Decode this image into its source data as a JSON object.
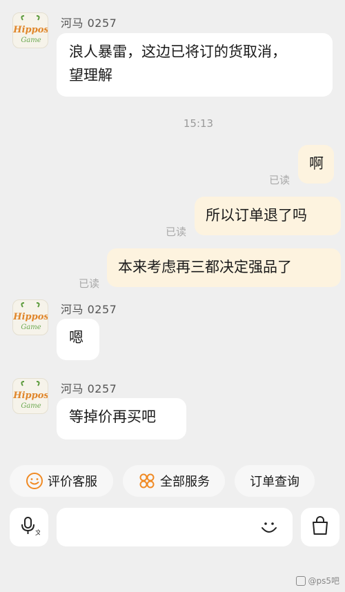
{
  "chat": {
    "messages": [
      {
        "sender": "河马 0257",
        "lines": [
          "浪人暴雷，这边已将订的货取消，",
          "望理解"
        ]
      },
      {
        "time": "15:13"
      },
      {
        "outgoing": "啊",
        "status": "已读"
      },
      {
        "outgoing": "所以订单退了吗",
        "status": "已读"
      },
      {
        "outgoing": "本来考虑再三都决定强品了",
        "status": "已读"
      },
      {
        "sender": "河马 0257",
        "text": "嗯"
      },
      {
        "sender": "河马 0257",
        "text": "等掉价再买吧"
      }
    ]
  },
  "avatar_logo": {
    "line1": "Hippos",
    "line2": "Game"
  },
  "quick_actions": [
    {
      "label": "评价客服",
      "icon": "smile-icon"
    },
    {
      "label": "全部服务",
      "icon": "grid-circles-icon"
    },
    {
      "label": "订单查询"
    }
  ],
  "input_bar": {
    "voice_icon": "voice-text-icon",
    "emoji_icon": "emoji-icon",
    "bag_icon": "shopping-bag-icon"
  },
  "watermark": "@ps5吧",
  "colors": {
    "bubble_in": "#ffffff",
    "bubble_out": "#fdf3df",
    "accent_orange": "#f08a24",
    "background": "#efefef"
  }
}
